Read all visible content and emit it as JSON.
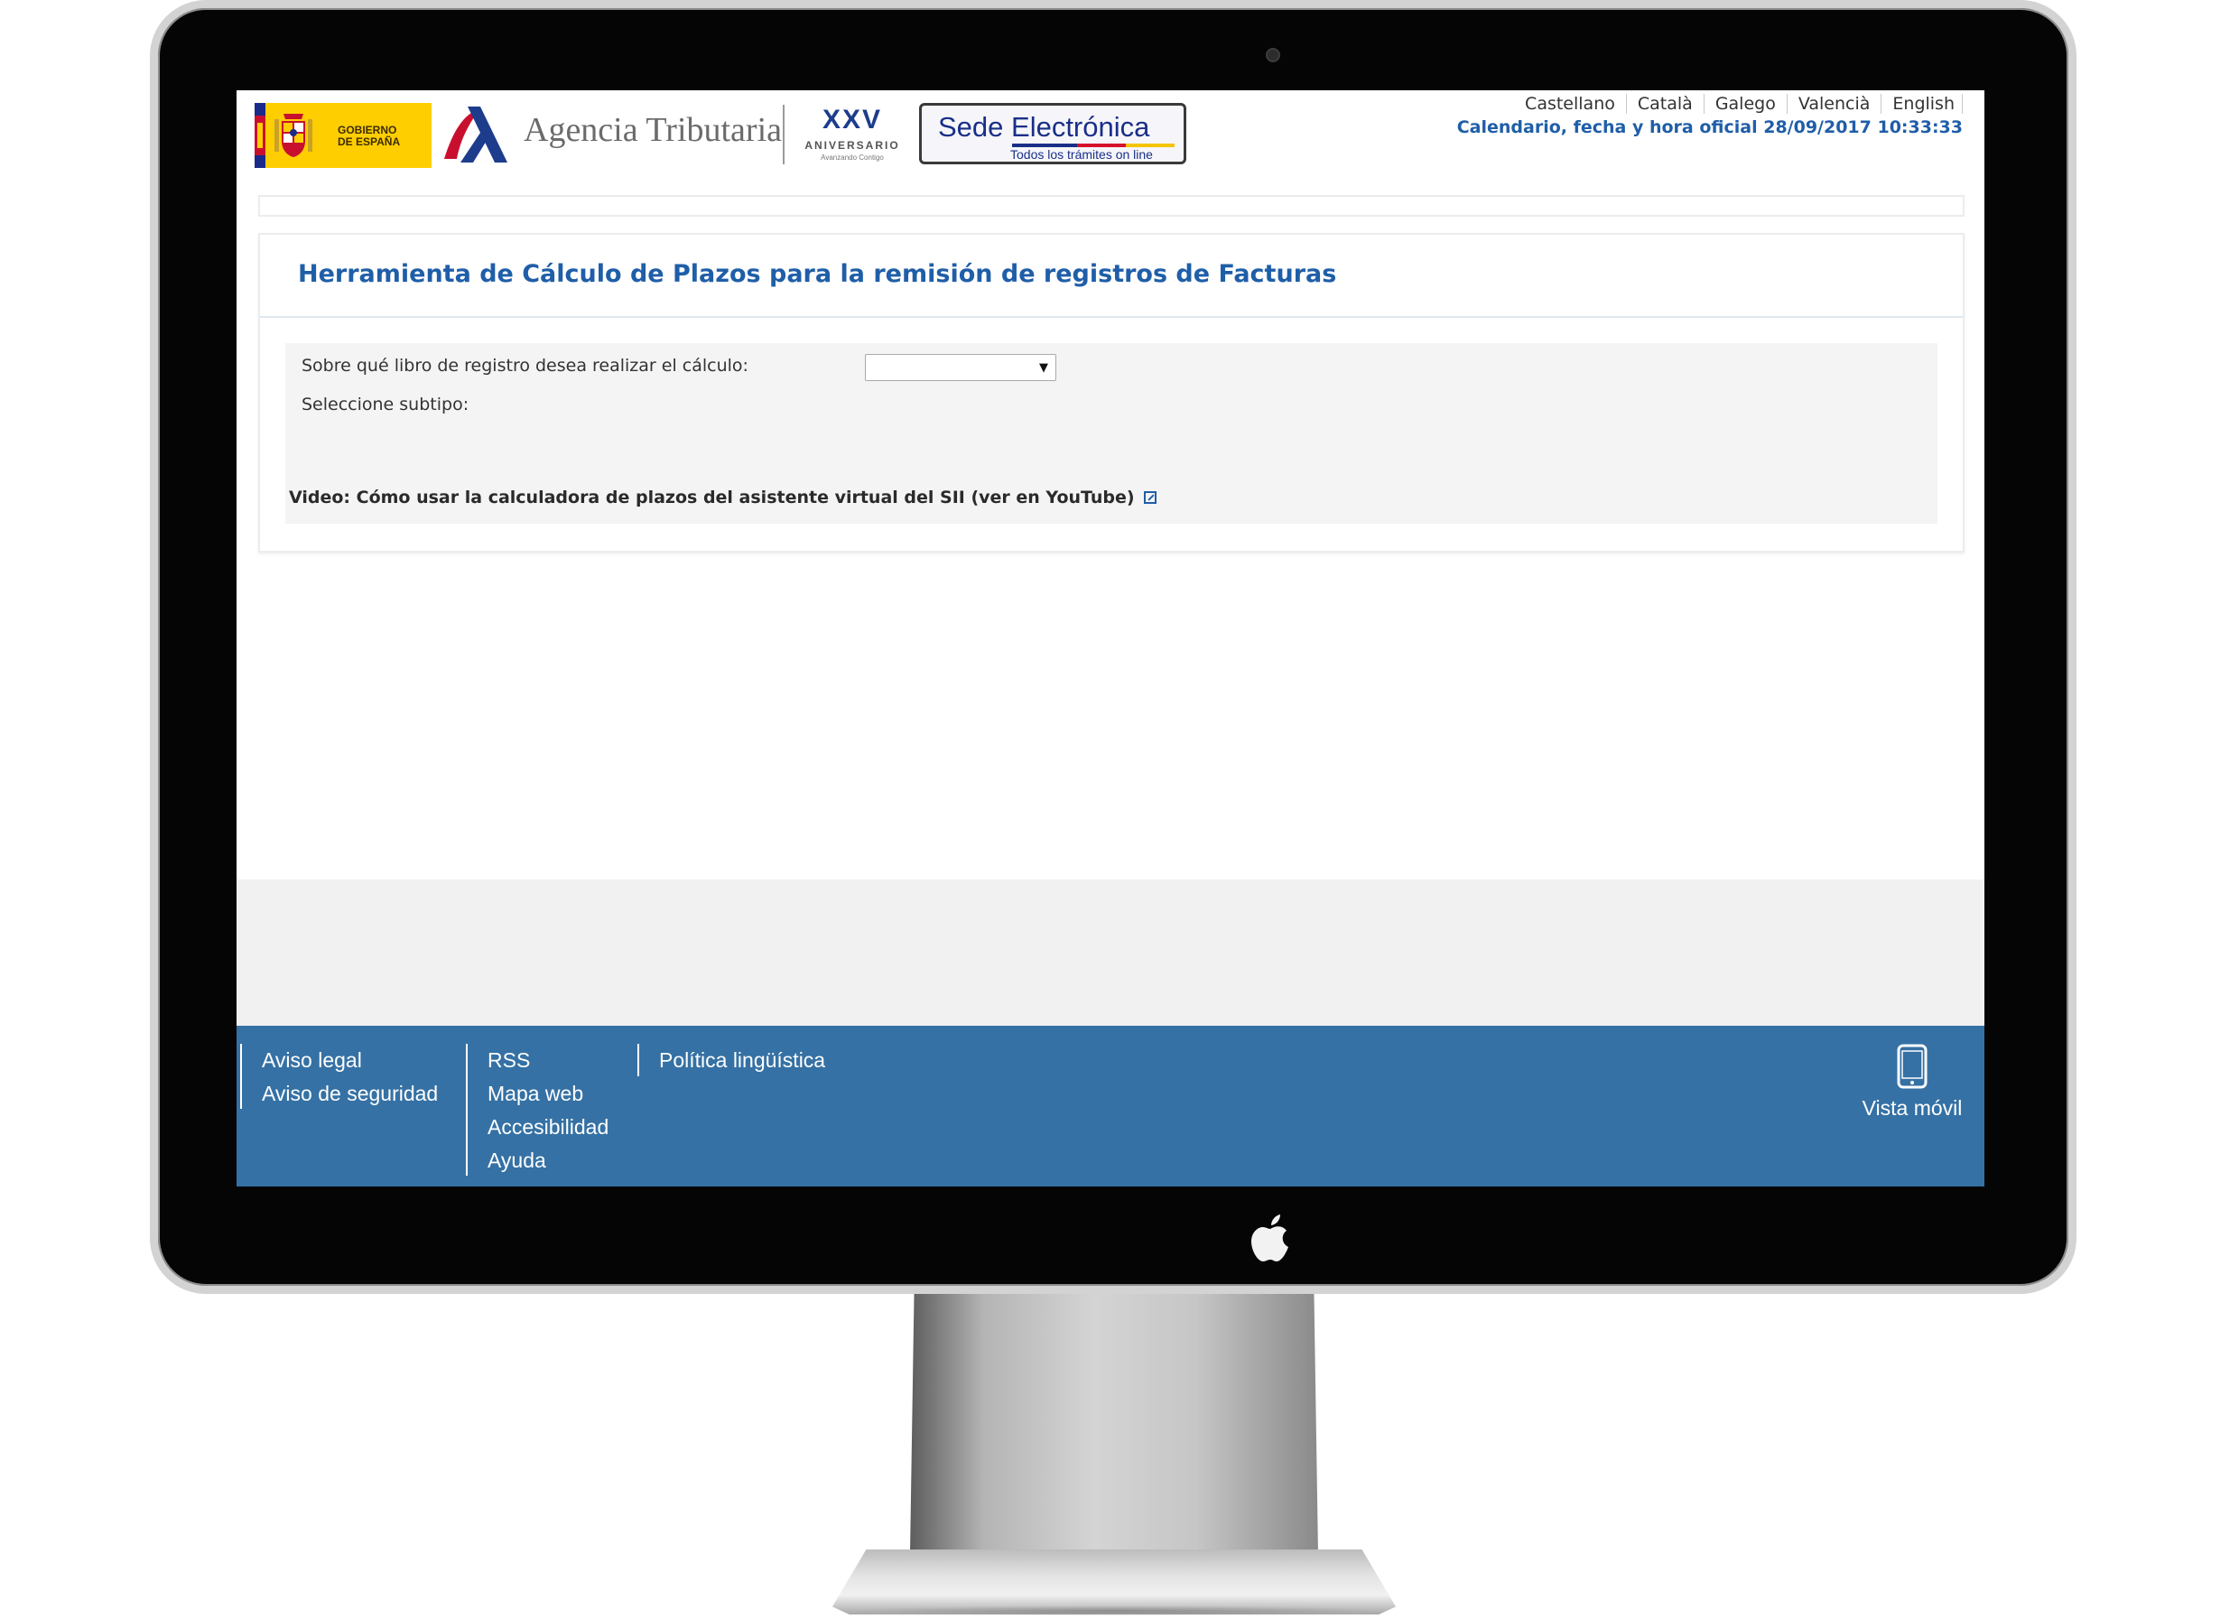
{
  "header": {
    "gov_logo_text": [
      "GOBIERNO",
      "DE ESPAÑA"
    ],
    "agency_name": "Agencia Tributaria",
    "anniversary_title": "XXV",
    "anniversary_sub": "ANIVERSARIO",
    "anniversary_tag": "Avanzando Contigo",
    "sede_title": "Sede Electrónica",
    "sede_subtitle": "Todos los trámites on line",
    "languages": [
      "Castellano",
      "Català",
      "Galego",
      "Valencià",
      "English"
    ],
    "calendar_text": "Calendario, fecha y hora oficial 28/09/2017 10:33:33"
  },
  "panel": {
    "title": "Herramienta de Cálculo de Plazos para la remisión de registros de Facturas",
    "libro_label": "Sobre qué libro de registro desea realizar el cálculo:",
    "libro_value": "",
    "subtipo_label": "Seleccione subtipo:",
    "video_link": "Video: Cómo usar la calculadora de plazos del asistente virtual del SII (ver en YouTube)"
  },
  "footer": {
    "col1": [
      "Aviso legal",
      "Aviso de seguridad"
    ],
    "col2": [
      "RSS",
      "Mapa web",
      "Accesibilidad",
      "Ayuda"
    ],
    "col3": [
      "Política lingüística"
    ],
    "mobile_label": "Vista móvil"
  },
  "colors": {
    "accent_blue": "#1f5ea8",
    "footer_blue": "#3571a4",
    "gov_yellow": "#fece01"
  },
  "icons": [
    "apple-icon",
    "camera-icon",
    "external-link-icon",
    "mobile-phone-icon",
    "dropdown-arrow-icon"
  ]
}
